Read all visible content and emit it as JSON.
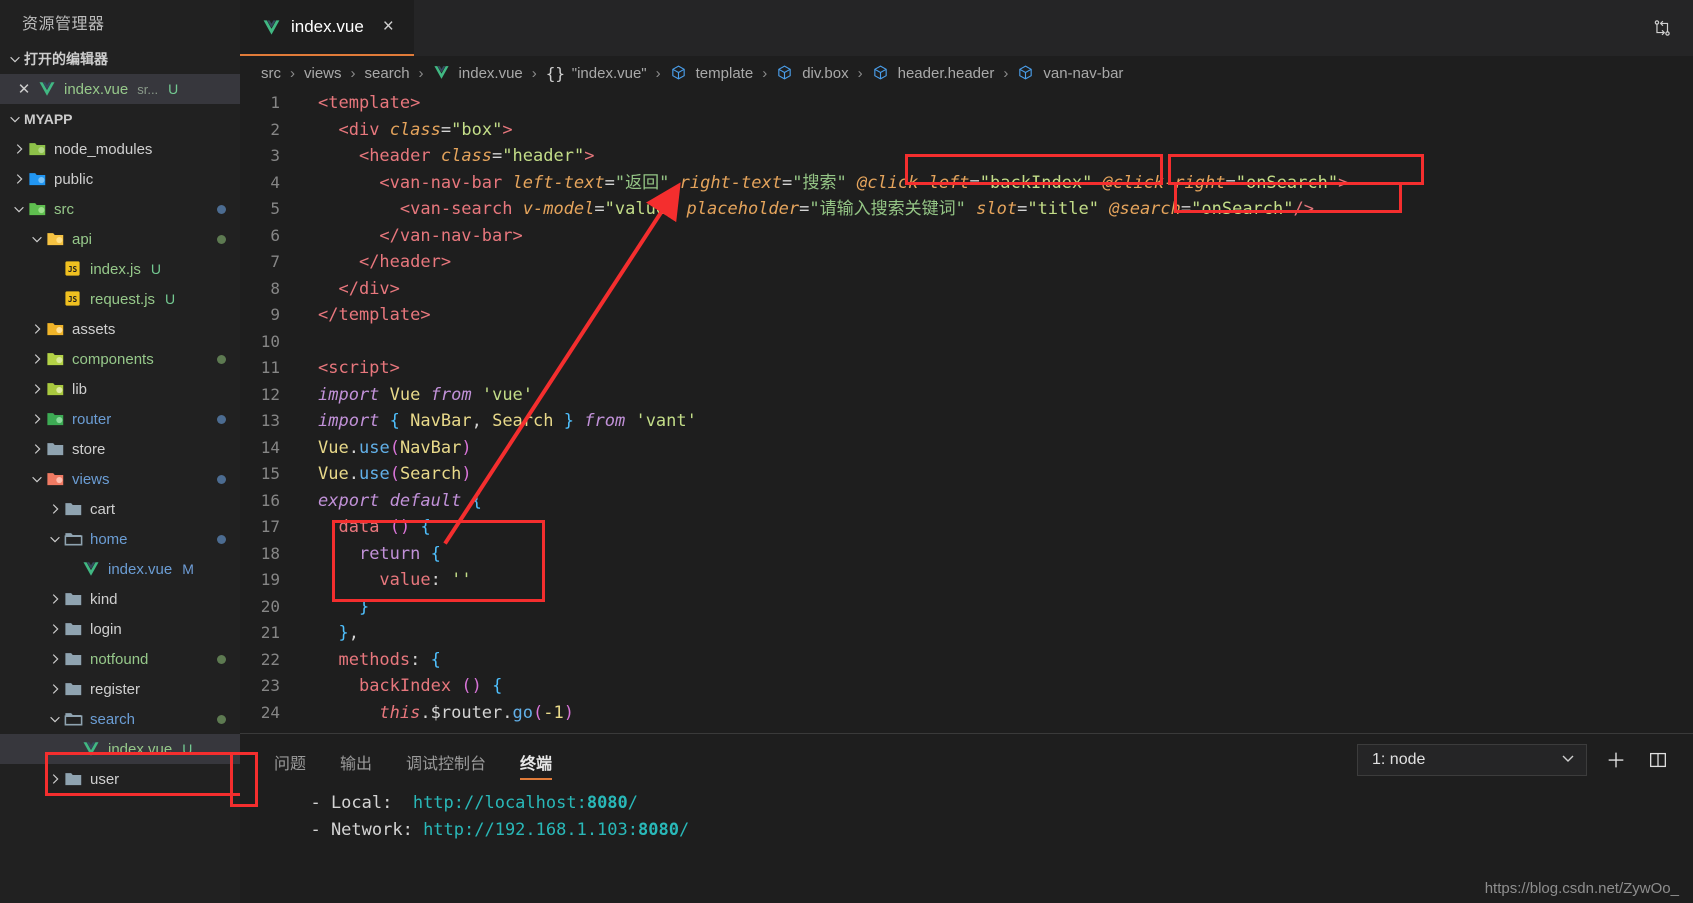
{
  "sidebar": {
    "title": "资源管理器",
    "open_editors": {
      "label": "打开的编辑器",
      "items": [
        {
          "name": "index.vue",
          "suffix": "sr...",
          "badge": "U",
          "icon": "vue-icon"
        }
      ]
    },
    "workspace": {
      "label": "MYAPP",
      "tree": [
        {
          "name": "node_modules",
          "type": "folder",
          "icon": "folder-node-icon",
          "indent": 1,
          "expanded": false,
          "badge": "",
          "dot": ""
        },
        {
          "name": "public",
          "type": "folder",
          "icon": "folder-public-icon",
          "indent": 1,
          "expanded": false,
          "badge": "",
          "dot": ""
        },
        {
          "name": "src",
          "type": "folder",
          "icon": "folder-src-icon",
          "indent": 1,
          "expanded": true,
          "badge": "",
          "dot": "#4c6c91"
        },
        {
          "name": "api",
          "type": "folder",
          "icon": "folder-api-icon",
          "indent": 2,
          "expanded": true,
          "badge": "",
          "dot": "#5d7a51"
        },
        {
          "name": "index.js",
          "type": "file",
          "icon": "js-icon",
          "indent": 3,
          "expanded": null,
          "badge": "U",
          "dot": ""
        },
        {
          "name": "request.js",
          "type": "file",
          "icon": "js-icon",
          "indent": 3,
          "expanded": null,
          "badge": "U",
          "dot": ""
        },
        {
          "name": "assets",
          "type": "folder",
          "icon": "folder-assets-icon",
          "indent": 2,
          "expanded": false,
          "badge": "",
          "dot": ""
        },
        {
          "name": "components",
          "type": "folder",
          "icon": "folder-components-icon",
          "indent": 2,
          "expanded": false,
          "badge": "",
          "dot": "#5d7a51"
        },
        {
          "name": "lib",
          "type": "folder",
          "icon": "folder-lib-icon",
          "indent": 2,
          "expanded": false,
          "badge": "",
          "dot": ""
        },
        {
          "name": "router",
          "type": "folder",
          "icon": "folder-router-icon",
          "indent": 2,
          "expanded": false,
          "badge": "",
          "dot": "#4c6c91"
        },
        {
          "name": "store",
          "type": "folder",
          "icon": "folder-plain-icon",
          "indent": 2,
          "expanded": false,
          "badge": "",
          "dot": ""
        },
        {
          "name": "views",
          "type": "folder",
          "icon": "folder-views-icon",
          "indent": 2,
          "expanded": true,
          "badge": "",
          "dot": "#4c6c91"
        },
        {
          "name": "cart",
          "type": "folder",
          "icon": "folder-plain-icon",
          "indent": 3,
          "expanded": false,
          "badge": "",
          "dot": ""
        },
        {
          "name": "home",
          "type": "folder",
          "icon": "folder-open-icon",
          "indent": 3,
          "expanded": true,
          "badge": "",
          "dot": "#4c6c91"
        },
        {
          "name": "index.vue",
          "type": "file",
          "icon": "vue-icon",
          "indent": 4,
          "expanded": null,
          "badge": "M",
          "dot": ""
        },
        {
          "name": "kind",
          "type": "folder",
          "icon": "folder-plain-icon",
          "indent": 3,
          "expanded": false,
          "badge": "",
          "dot": ""
        },
        {
          "name": "login",
          "type": "folder",
          "icon": "folder-plain-icon",
          "indent": 3,
          "expanded": false,
          "badge": "",
          "dot": ""
        },
        {
          "name": "notfound",
          "type": "folder",
          "icon": "folder-plain-icon",
          "indent": 3,
          "expanded": false,
          "badge": "",
          "dot": "#5d7a51"
        },
        {
          "name": "register",
          "type": "folder",
          "icon": "folder-plain-icon",
          "indent": 3,
          "expanded": false,
          "badge": "",
          "dot": ""
        },
        {
          "name": "search",
          "type": "folder",
          "icon": "folder-open-icon",
          "indent": 3,
          "expanded": true,
          "badge": "",
          "dot": "#5d7a51"
        },
        {
          "name": "index.vue",
          "type": "file",
          "icon": "vue-icon",
          "indent": 4,
          "expanded": null,
          "badge": "U",
          "dot": "",
          "selected": true
        },
        {
          "name": "user",
          "type": "folder",
          "icon": "folder-plain-icon",
          "indent": 3,
          "expanded": false,
          "badge": "",
          "dot": ""
        }
      ]
    }
  },
  "tabbar": {
    "tabs": [
      {
        "label": "index.vue",
        "icon": "vue-icon",
        "active": true,
        "close": "×"
      }
    ],
    "right_icon": "split-editor-icon"
  },
  "breadcrumb": [
    {
      "label": "src",
      "icon": ""
    },
    {
      "label": "views",
      "icon": ""
    },
    {
      "label": "search",
      "icon": ""
    },
    {
      "label": "index.vue",
      "icon": "vue-icon"
    },
    {
      "label": "\"index.vue\"",
      "icon": "braces-icon"
    },
    {
      "label": "template",
      "icon": "symbol-cube-icon"
    },
    {
      "label": "div.box",
      "icon": "symbol-cube-icon"
    },
    {
      "label": "header.header",
      "icon": "symbol-cube-icon"
    },
    {
      "label": "van-nav-bar",
      "icon": "symbol-cube-icon"
    }
  ],
  "editor": {
    "lines": [
      {
        "n": "1",
        "text": "<template>"
      },
      {
        "n": "2",
        "text": "  <div class=\"box\">"
      },
      {
        "n": "3",
        "text": "    <header class=\"header\">"
      },
      {
        "n": "4",
        "text": "      <van-nav-bar left-text=\"返回\" right-text=\"搜索\" @click-left=\"backIndex\" @click-right=\"onSearch\">"
      },
      {
        "n": "5",
        "text": "        <van-search v-model=\"value\" placeholder=\"请输入搜索关键词\" slot=\"title\" @search=\"onSearch\"/>"
      },
      {
        "n": "6",
        "text": "      </van-nav-bar>"
      },
      {
        "n": "7",
        "text": "    </header>"
      },
      {
        "n": "8",
        "text": "  </div>"
      },
      {
        "n": "9",
        "text": "</template>"
      },
      {
        "n": "10",
        "text": ""
      },
      {
        "n": "11",
        "text": "<script>"
      },
      {
        "n": "12",
        "text": "import Vue from 'vue'"
      },
      {
        "n": "13",
        "text": "import { NavBar, Search } from 'vant'"
      },
      {
        "n": "14",
        "text": "Vue.use(NavBar)"
      },
      {
        "n": "15",
        "text": "Vue.use(Search)"
      },
      {
        "n": "16",
        "text": "export default {"
      },
      {
        "n": "17",
        "text": "  data () {"
      },
      {
        "n": "18",
        "text": "    return {"
      },
      {
        "n": "19",
        "text": "      value: ''"
      },
      {
        "n": "20",
        "text": "    }"
      },
      {
        "n": "21",
        "text": "  },"
      },
      {
        "n": "22",
        "text": "  methods: {"
      },
      {
        "n": "23",
        "text": "    backIndex () {"
      },
      {
        "n": "24",
        "text": "      this.$router.go(-1)"
      }
    ]
  },
  "panel": {
    "tabs": [
      {
        "label": "问题",
        "active": false
      },
      {
        "label": "输出",
        "active": false
      },
      {
        "label": "调试控制台",
        "active": false
      },
      {
        "label": "终端",
        "active": true
      }
    ],
    "terminal_select": {
      "value": "1: node",
      "chevron": "chevron-down-icon"
    },
    "add_icon": "plus-icon",
    "split_icon": "split-terminal-icon",
    "output": [
      {
        "label": "  - Local:  ",
        "url": "http://localhost:",
        "port": "8080",
        "tail": "/"
      },
      {
        "label": "  - Network:",
        "url": " http://192.168.1.103:",
        "port": "8080",
        "tail": "/"
      }
    ]
  },
  "watermark": "https://blog.csdn.net/ZywOo_",
  "colors": {
    "accent_orange": "#e07b39",
    "annotation_red": "#f42e2e",
    "editor_bg": "#1e1e1e",
    "sidebar_bg": "#212121"
  }
}
